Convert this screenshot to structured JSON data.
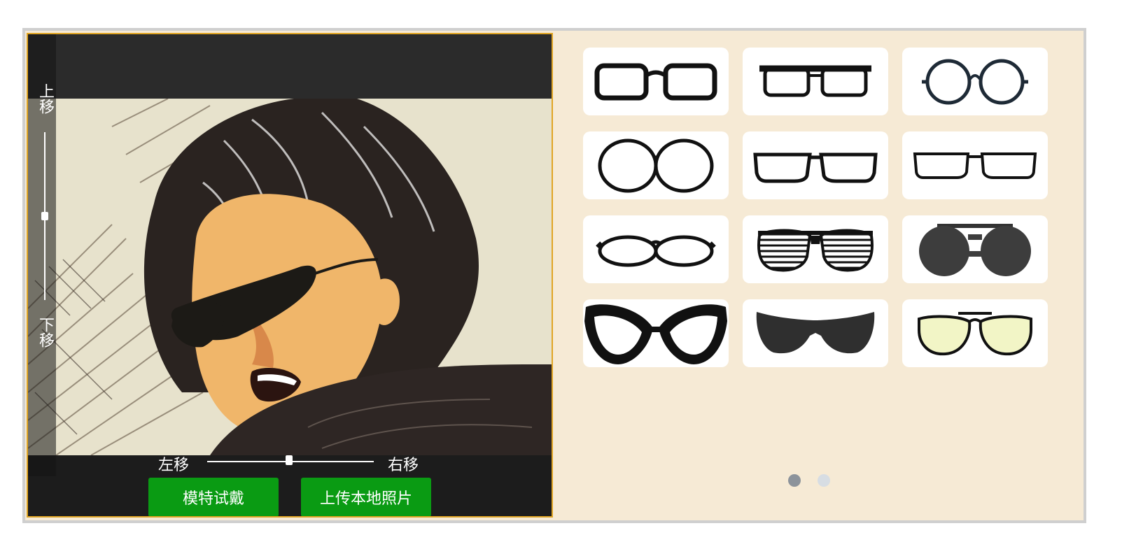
{
  "controls": {
    "move_up": "上移",
    "move_down": "下移",
    "move_left": "左移",
    "move_right": "右移"
  },
  "buttons": {
    "model_try_on": "模特试戴",
    "upload_local_photo": "上传本地照片"
  },
  "colors": {
    "accent_border": "#e0a524",
    "button_green": "#0a9b13",
    "panel_bg": "#f6ead5"
  },
  "glasses_styles": [
    "rectangle-thick",
    "rectangle-browline",
    "round-thin",
    "round-thick",
    "rectangle-slim",
    "rectangle-narrow",
    "oval",
    "shutter-shades",
    "round-sunglasses-flat-top",
    "cat-eye",
    "wrap-sunglasses",
    "aviator-yellow"
  ],
  "pagination": {
    "active_page": 1,
    "pages": 2
  }
}
